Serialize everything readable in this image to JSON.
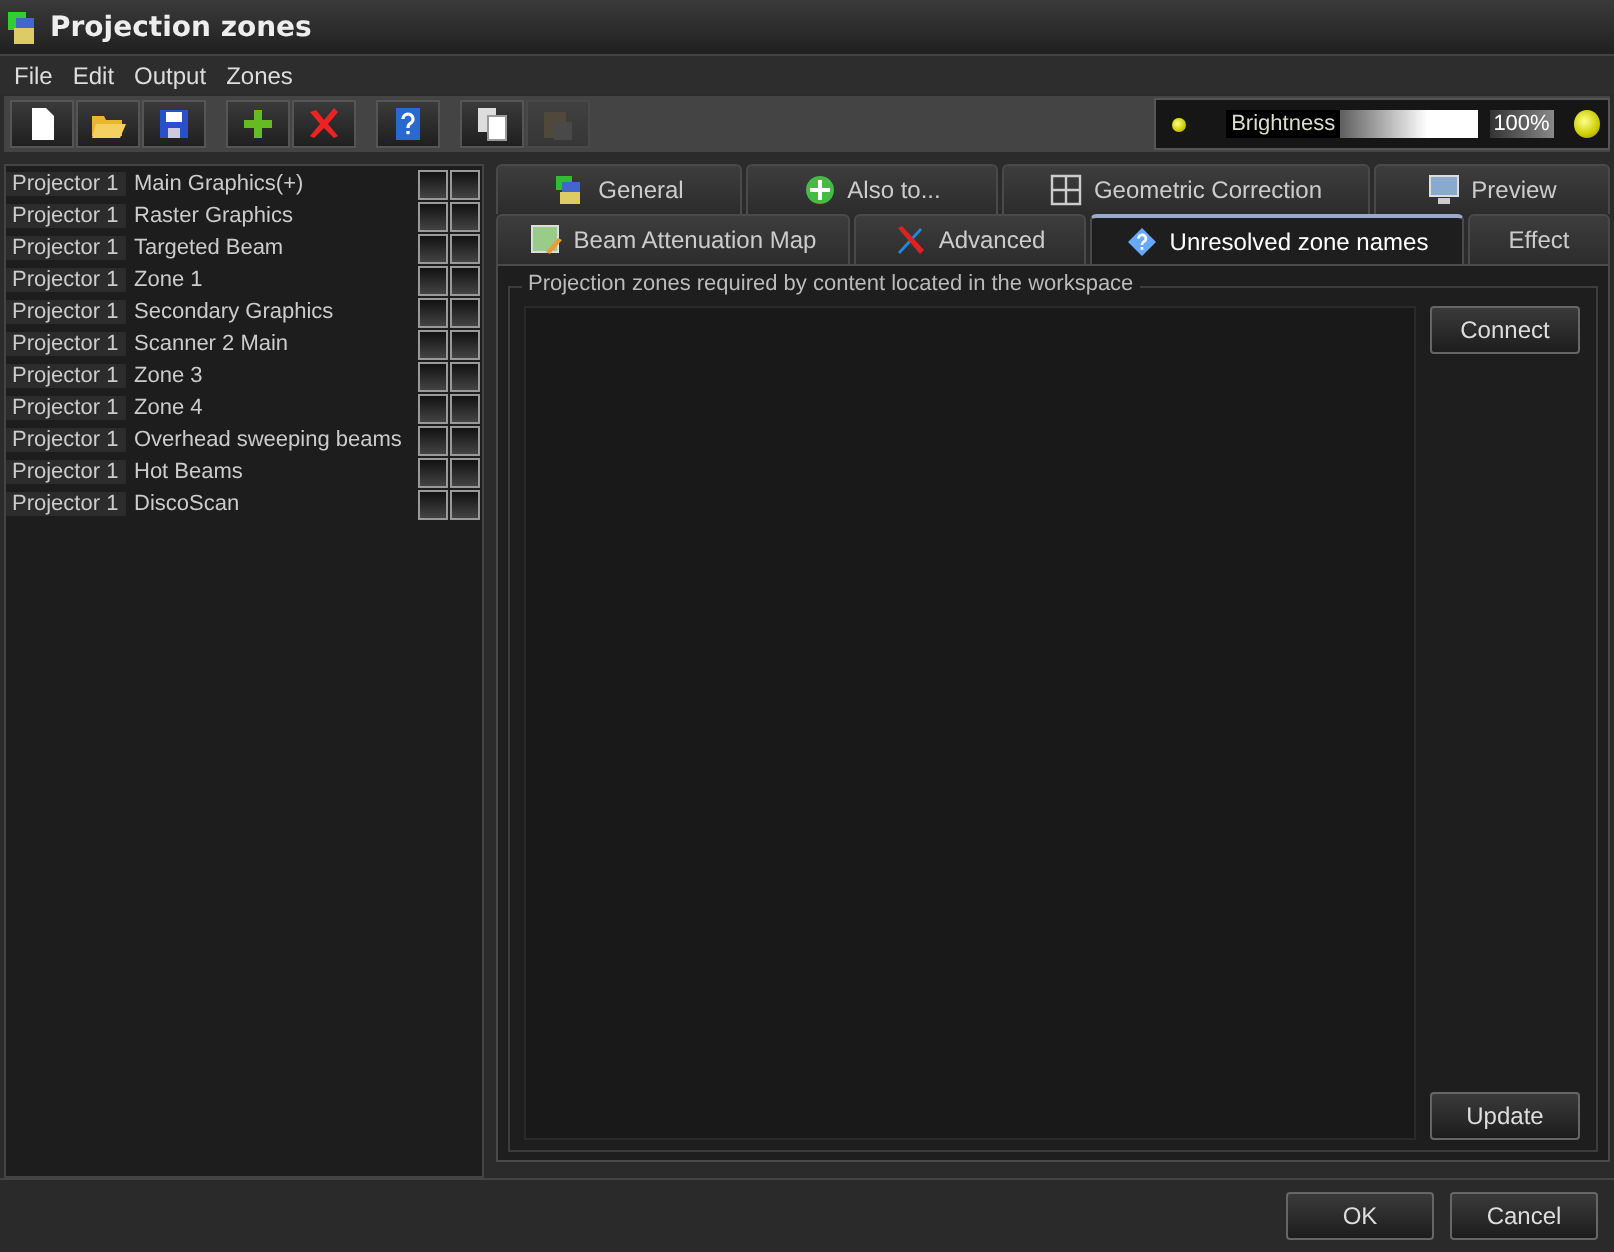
{
  "window": {
    "title": "Projection zones"
  },
  "menu": [
    "File",
    "Edit",
    "Output",
    "Zones"
  ],
  "toolbar": [
    {
      "kind": "new",
      "disabled": false
    },
    {
      "kind": "open",
      "disabled": false
    },
    {
      "kind": "save",
      "disabled": false
    },
    {
      "kind": "add",
      "disabled": false
    },
    {
      "kind": "delete",
      "disabled": false
    },
    {
      "kind": "help",
      "disabled": false
    },
    {
      "kind": "copy",
      "disabled": false
    },
    {
      "kind": "paste",
      "disabled": true
    }
  ],
  "brightness": {
    "label": "Brightness",
    "level": 1.0,
    "reading": "100%"
  },
  "zones": [
    {
      "projector": "Projector 1",
      "name": "Main Graphics(+)",
      "checks": [
        false,
        false
      ]
    },
    {
      "projector": "Projector 1",
      "name": "Raster Graphics",
      "checks": [
        false,
        false
      ]
    },
    {
      "projector": "Projector 1",
      "name": "Targeted Beam",
      "checks": [
        false,
        false
      ]
    },
    {
      "projector": "Projector 1",
      "name": "Zone 1",
      "checks": [
        false,
        false
      ]
    },
    {
      "projector": "Projector 1",
      "name": "Secondary Graphics",
      "checks": [
        false,
        false
      ]
    },
    {
      "projector": "Projector 1",
      "name": "Scanner 2 Main",
      "checks": [
        false,
        false
      ]
    },
    {
      "projector": "Projector 1",
      "name": "Zone 3",
      "checks": [
        false,
        false
      ]
    },
    {
      "projector": "Projector 1",
      "name": "Zone 4",
      "checks": [
        false,
        false
      ]
    },
    {
      "projector": "Projector 1",
      "name": "Overhead sweeping beams",
      "checks": [
        false,
        false
      ]
    },
    {
      "projector": "Projector 1",
      "name": "Hot Beams",
      "checks": [
        false,
        false
      ]
    },
    {
      "projector": "Projector 1",
      "name": "DiscoScan",
      "checks": [
        false,
        false
      ]
    }
  ],
  "tab_rows": [
    [
      {
        "label": "General",
        "kind": "general",
        "selected": false
      },
      {
        "label": "Also to...",
        "kind": "plus",
        "selected": false
      },
      {
        "label": "Geometric Correction",
        "kind": "grid",
        "selected": false
      },
      {
        "label": "Preview",
        "kind": "monitor",
        "selected": false
      }
    ],
    [
      {
        "label": "Beam Attenuation Map",
        "kind": "map",
        "selected": false
      },
      {
        "label": "Advanced",
        "kind": "tools",
        "selected": false
      },
      {
        "label": "Unresolved zone names",
        "kind": "question",
        "selected": true
      },
      {
        "label": "Effect",
        "kind": "none",
        "selected": false
      }
    ]
  ],
  "group": {
    "title": "Projection zones required by content located in the workspace",
    "buttons": [
      "Connect",
      "Update"
    ]
  },
  "buttons": [
    "OK",
    "Cancel"
  ]
}
